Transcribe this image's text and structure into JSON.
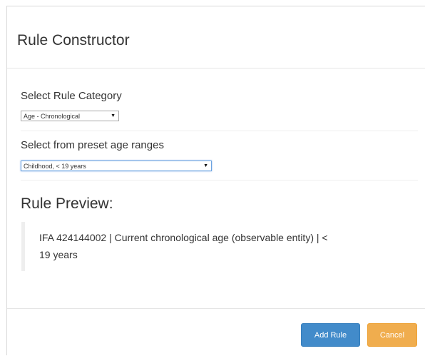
{
  "modal": {
    "title": "Rule Constructor"
  },
  "rule_category": {
    "label": "Select Rule Category",
    "selected": "Age - Chronological"
  },
  "age_range": {
    "label": "Select from preset age ranges",
    "selected": "Childhood, < 19 years"
  },
  "preview": {
    "heading": "Rule Preview:",
    "line1": "IFA 424144002 | Current chronological age (observable entity) | <",
    "line2": "19 years"
  },
  "footer": {
    "add_label": "Add Rule",
    "cancel_label": "Cancel"
  },
  "colors": {
    "primary": "#428bca",
    "warning": "#f0ad4e",
    "focus_border": "#6ba3e0"
  },
  "icons": {
    "dropdown": "caret-down-icon"
  }
}
